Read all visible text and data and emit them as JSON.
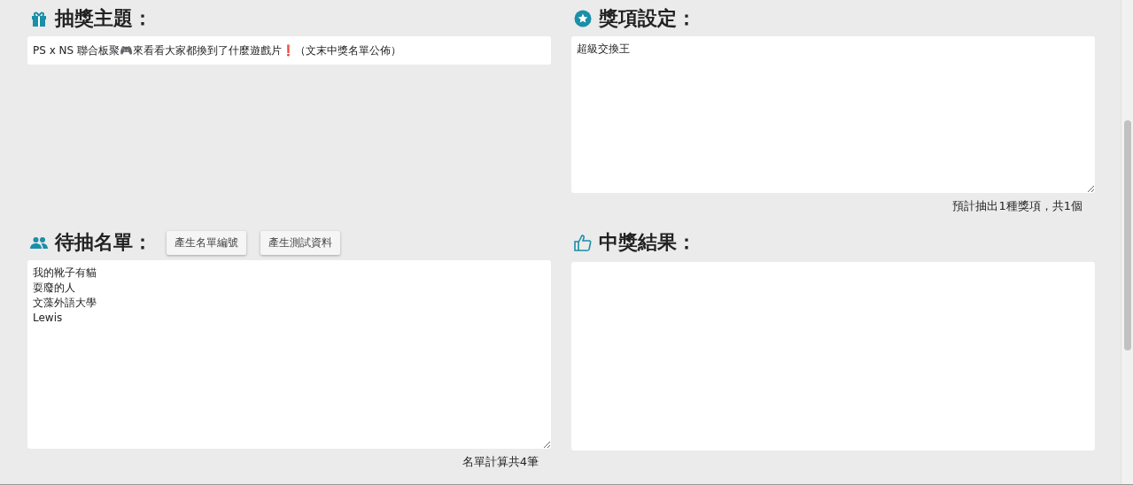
{
  "topic": {
    "heading": "抽獎主題：",
    "value": "PS x NS 聯合板聚🎮來看看大家都換到了什麼遊戲片❗（文末中獎名單公佈）"
  },
  "prizes": {
    "heading": "獎項設定：",
    "lines": [
      "超級交換王"
    ],
    "summary": "預計抽出1種獎項，共1個"
  },
  "entrants": {
    "heading": "待抽名單：",
    "buttons": [
      "產生名單編號",
      "產生測試資料"
    ],
    "lines": [
      "我的靴子有貓",
      "耍廢的人",
      "文藻外語大學",
      "Lewis"
    ],
    "summary": "名單計算共4筆"
  },
  "results": {
    "heading": "中獎結果："
  }
}
